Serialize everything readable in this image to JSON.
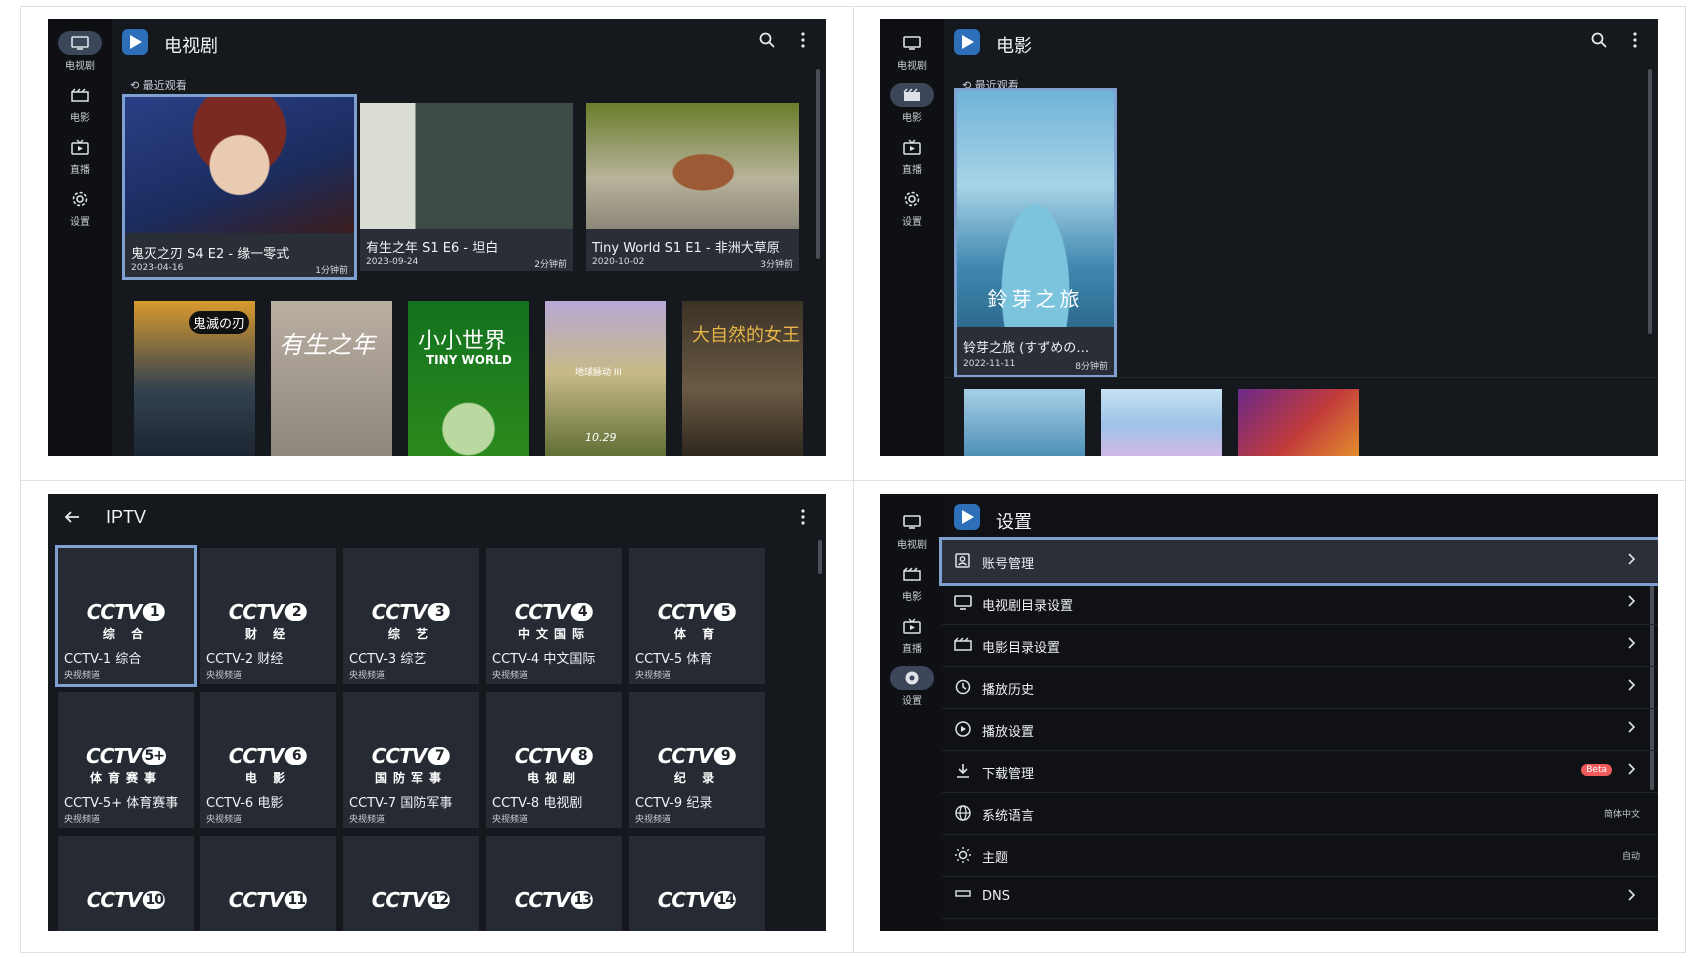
{
  "nav": {
    "tv": "电视剧",
    "movie": "电影",
    "live": "直播",
    "settings": "设置"
  },
  "panel_tv": {
    "title": "电视剧",
    "recent_label": "最近观看",
    "cards": [
      {
        "title": "鬼灭之刃 S4 E2 - 缘一零式",
        "date": "2023-04-16",
        "ago": "1分钟前"
      },
      {
        "title": "有生之年 S1 E6 - 坦白",
        "date": "2023-09-24",
        "ago": "2分钟前"
      },
      {
        "title": "Tiny World S1 E1 - 非洲大草原",
        "date": "2020-10-02",
        "ago": "3分钟前"
      }
    ],
    "posters": [
      {
        "text": "鬼滅の刃"
      },
      {
        "text": "有生之年"
      },
      {
        "text": "小小世界",
        "sub": "TINY WORLD"
      },
      {
        "text": "地球脉动 III",
        "date": "10.29"
      },
      {
        "text": "大自然的女王"
      }
    ]
  },
  "panel_movie": {
    "title": "电影",
    "recent_label": "最近观看",
    "card": {
      "title": "铃芽之旅 (すずめの…",
      "date": "2022-11-11",
      "ago": "8分钟前",
      "poster_text": "鈴芽之旅"
    }
  },
  "panel_iptv": {
    "title": "IPTV",
    "channels": [
      {
        "num": "1",
        "sub": "综 合",
        "name": "CCTV-1 综合",
        "desc": "央视频道"
      },
      {
        "num": "2",
        "sub": "财 经",
        "name": "CCTV-2 财经",
        "desc": "央视频道"
      },
      {
        "num": "3",
        "sub": "综 艺",
        "name": "CCTV-3 综艺",
        "desc": "央视频道"
      },
      {
        "num": "4",
        "sub": "中文国际",
        "name": "CCTV-4 中文国际",
        "desc": "央视频道"
      },
      {
        "num": "5",
        "sub": "体 育",
        "name": "CCTV-5 体育",
        "desc": "央视频道"
      },
      {
        "num": "5+",
        "sub": "体育赛事",
        "name": "CCTV-5+ 体育赛事",
        "desc": "央视频道"
      },
      {
        "num": "6",
        "sub": "电 影",
        "name": "CCTV-6 电影",
        "desc": "央视频道"
      },
      {
        "num": "7",
        "sub": "国防军事",
        "name": "CCTV-7 国防军事",
        "desc": "央视频道"
      },
      {
        "num": "8",
        "sub": "电视剧",
        "name": "CCTV-8 电视剧",
        "desc": "央视频道"
      },
      {
        "num": "9",
        "sub": "纪 录",
        "name": "CCTV-9 纪录",
        "desc": "央视频道"
      },
      {
        "num": "10"
      },
      {
        "num": "11"
      },
      {
        "num": "12"
      },
      {
        "num": "13"
      },
      {
        "num": "14"
      }
    ],
    "logo_text": "CCTV"
  },
  "panel_settings": {
    "title": "设置",
    "items": [
      {
        "label": "账号管理"
      },
      {
        "label": "电视剧目录设置"
      },
      {
        "label": "电影目录设置"
      },
      {
        "label": "播放历史"
      },
      {
        "label": "播放设置"
      },
      {
        "label": "下载管理",
        "badge": "Beta"
      },
      {
        "label": "系统语言",
        "value": "简体中文"
      },
      {
        "label": "主题",
        "value": "自动"
      },
      {
        "label": "DNS"
      }
    ]
  },
  "colors": {
    "accent": "#7ea1d2",
    "bg": "#15181d",
    "beta": "#f05a5a"
  }
}
